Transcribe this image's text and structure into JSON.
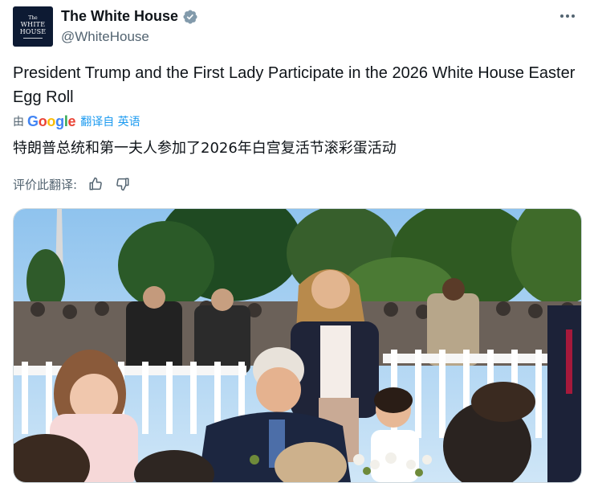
{
  "account": {
    "avatar_text_top": "The",
    "avatar_text_main": "WHITE\nHOUSE",
    "display_name": "The White House",
    "handle": "@WhiteHouse",
    "verified": true,
    "verified_icon": "verified-badge-icon",
    "verified_color": "#829aab"
  },
  "menu": {
    "icon": "more-options-icon"
  },
  "tweet": {
    "text": "President Trump and the First Lady Participate in the 2026 White House Easter Egg Roll"
  },
  "translation": {
    "by_label": "由",
    "provider": "Google",
    "translated_from_label": "翻译自 英语",
    "translated_text": "特朗普总统和第一夫人参加了2026年白宫复活节滚彩蛋活动",
    "rate_label": "评价此翻译:",
    "thumbs_up_icon": "thumbs-up-icon",
    "thumbs_down_icon": "thumbs-down-icon"
  },
  "media": {
    "type": "photo",
    "icon": "photo-image"
  },
  "colors": {
    "text_primary": "#0f1419",
    "text_secondary": "#536471",
    "link": "#1d9bf0",
    "border": "#cfd9de"
  }
}
